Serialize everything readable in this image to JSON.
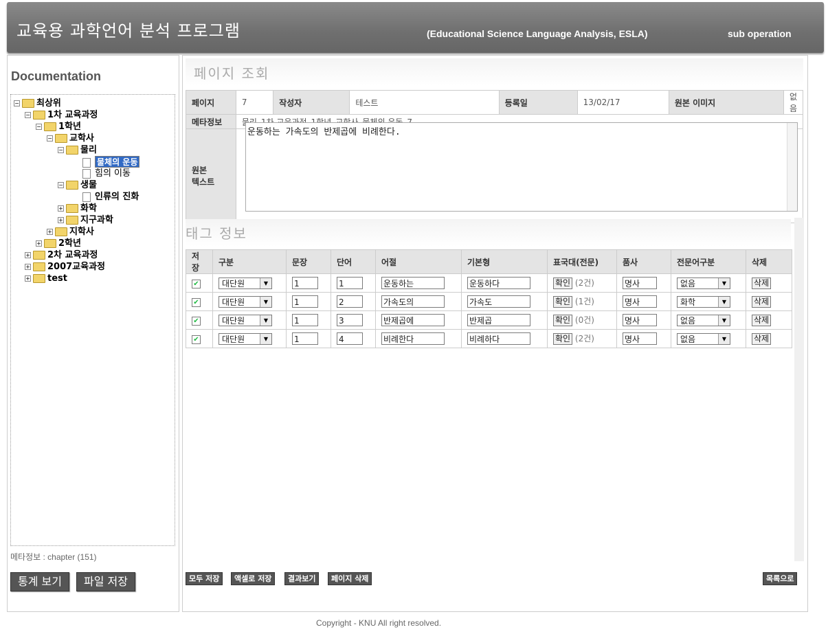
{
  "header": {
    "title": "교육용 과학언어 분석 프로그램",
    "subtitle": "(Educational Science Language Analysis, ESLA)",
    "sub_operation": "sub operation"
  },
  "sidebar": {
    "title": "Documentation",
    "tree": [
      {
        "label": "최상위",
        "expander": "minus",
        "icon": "folder-open-icon"
      },
      {
        "label": "1차 교육과정",
        "expander": "minus",
        "icon": "folder-open-icon"
      },
      {
        "label": "1학년",
        "expander": "minus",
        "icon": "folder-open-icon"
      },
      {
        "label": "교학사",
        "expander": "minus",
        "icon": "folder-open-icon"
      },
      {
        "label": "물리",
        "expander": "minus",
        "icon": "folder-open-icon"
      },
      {
        "label": "물체의 운동",
        "expander": "none",
        "icon": "file-icon",
        "selected": true
      },
      {
        "label": "힘의 이동",
        "expander": "none",
        "icon": "file-icon"
      },
      {
        "label": "생물",
        "expander": "minus",
        "icon": "folder-open-icon"
      },
      {
        "label": "인류의 진화",
        "expander": "none",
        "icon": "file-icon"
      },
      {
        "label": "화학",
        "expander": "plus",
        "icon": "folder-icon"
      },
      {
        "label": "지구과학",
        "expander": "plus",
        "icon": "folder-icon"
      },
      {
        "label": "지학사",
        "expander": "plus",
        "icon": "folder-icon"
      },
      {
        "label": "2학년",
        "expander": "plus",
        "icon": "folder-icon"
      },
      {
        "label": "2차 교육과정",
        "expander": "plus",
        "icon": "folder-icon"
      },
      {
        "label": "2007교육과정",
        "expander": "plus",
        "icon": "folder-icon"
      },
      {
        "label": "test",
        "expander": "plus",
        "icon": "folder-icon"
      }
    ],
    "meta": "메타정보 : chapter (151)",
    "stats_button": "통계 보기",
    "save_file_button": "파일 저장"
  },
  "page_view": {
    "title": "페이지 조회",
    "labels": {
      "page": "페이지",
      "author": "작성자",
      "reg_date": "등록일",
      "orig_image": "원본 이미지",
      "meta": "메타정보",
      "orig_text_1": "원본",
      "orig_text_2": "텍스트"
    },
    "values": {
      "page": "7",
      "author": "테스트",
      "reg_date": "13/02/17",
      "orig_image": "없음",
      "meta": "물리_1차 교육과정_1학년_교학사_물체의 운동_7",
      "orig_text": "운동하는 가속도의 반제곱에 비례한다."
    }
  },
  "tag_info": {
    "title": "태그 정보",
    "columns": [
      "저장",
      "구분",
      "문장",
      "단어",
      "어절",
      "기본형",
      "표국대(전문)",
      "품사",
      "전문어구분",
      "삭제"
    ],
    "check_label": "확인",
    "delete_label": "삭제",
    "rows": [
      {
        "checked": true,
        "category": "대단원",
        "sentence": "1",
        "word": "1",
        "eojeol": "운동하는",
        "base": "운동하다",
        "count": "(2건)",
        "pos": "명사",
        "term_type": "없음"
      },
      {
        "checked": true,
        "category": "대단원",
        "sentence": "1",
        "word": "2",
        "eojeol": "가속도의",
        "base": "가속도",
        "count": "(1건)",
        "pos": "명사",
        "term_type": "화학"
      },
      {
        "checked": true,
        "category": "대단원",
        "sentence": "1",
        "word": "3",
        "eojeol": "반제곱에",
        "base": "반제곱",
        "count": "(0건)",
        "pos": "명사",
        "term_type": "없음"
      },
      {
        "checked": true,
        "category": "대단원",
        "sentence": "1",
        "word": "4",
        "eojeol": "비례한다",
        "base": "비례하다",
        "count": "(2건)",
        "pos": "명사",
        "term_type": "없음"
      }
    ]
  },
  "footer_buttons": {
    "save_all": "모두 저장",
    "save_excel": "액셀로 저장",
    "view_results": "결과보기",
    "delete_page": "페이지 삭제",
    "back_to_list": "목록으로"
  },
  "footer": {
    "copyright": "Copyright - KNU    All right resolved."
  }
}
